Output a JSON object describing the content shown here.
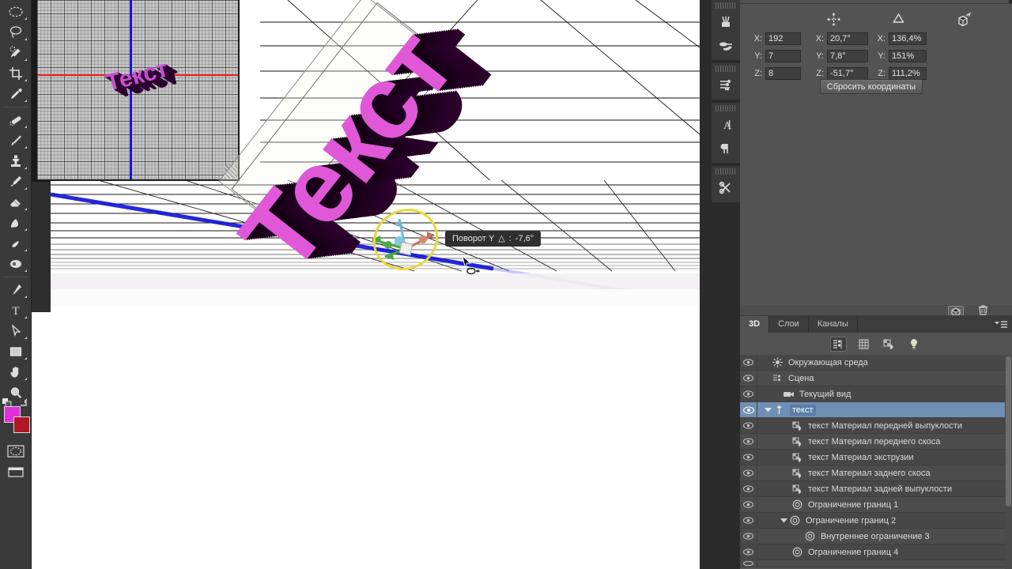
{
  "app": {
    "name": "Adobe Photoshop 3D",
    "locale": "ru"
  },
  "toolbar": {
    "tools": [
      {
        "name": "elliptical-marquee-icon",
        "label": "Овальная область"
      },
      {
        "name": "lasso-icon",
        "label": "Лассо"
      },
      {
        "name": "quick-selection-icon",
        "label": "Быстрое выделение"
      },
      {
        "name": "crop-icon",
        "label": "Рамка"
      },
      {
        "name": "eyedropper-icon",
        "label": "Пипетка"
      },
      {
        "name": "spot-healing-icon",
        "label": "Точечная восстанавливающая кисть"
      },
      {
        "name": "brush-icon",
        "label": "Кисть"
      },
      {
        "name": "clone-stamp-icon",
        "label": "Штамп"
      },
      {
        "name": "history-brush-icon",
        "label": "Архивная кисть"
      },
      {
        "name": "eraser-icon",
        "label": "Ластик"
      },
      {
        "name": "gradient-icon",
        "label": "Градиент"
      },
      {
        "name": "blur-icon",
        "label": "Размытие"
      },
      {
        "name": "dodge-icon",
        "label": "Осветлитель"
      },
      {
        "name": "pen-icon",
        "label": "Перо"
      },
      {
        "name": "type-icon",
        "label": "Текст"
      },
      {
        "name": "path-selection-icon",
        "label": "Выделение контура"
      },
      {
        "name": "rectangle-shape-icon",
        "label": "Прямоугольник"
      },
      {
        "name": "hand-icon",
        "label": "Рука"
      },
      {
        "name": "zoom-icon",
        "label": "Масштаб"
      }
    ],
    "foreground_color": "#e02fd8",
    "background_color": "#b0182a",
    "quickmask_label": "Быстрая маска"
  },
  "canvas": {
    "object_text": "Текст",
    "object_color": "#e058d8",
    "extrusion_color": "#1a001a",
    "rotation_ring_color": "#e8d73a",
    "tooltip": {
      "label": "Поворот Y",
      "symbol": "△",
      "separator": ":",
      "value": "-7,6°"
    },
    "preview": {
      "grid_background": "#c8c8c8",
      "x_axis_color": "#ee1c1c",
      "y_axis_color": "#1414d8"
    },
    "ground_axis_color": "#1414d8"
  },
  "minidock": {
    "groups": [
      {
        "items": [
          {
            "name": "brush-presets-icon",
            "label": "Наборы кистей"
          },
          {
            "name": "brush-settings-icon",
            "label": "Кисть"
          }
        ]
      },
      {
        "items": [
          {
            "name": "adjustments-icon",
            "label": "Коррекция"
          }
        ]
      },
      {
        "items": [
          {
            "name": "character-icon",
            "label": "Символ"
          },
          {
            "name": "paragraph-icon",
            "label": "Абзац"
          }
        ]
      },
      {
        "items": [
          {
            "name": "tool-presets-icon",
            "label": "Наборы инструментов"
          }
        ]
      }
    ]
  },
  "properties": {
    "columns": [
      {
        "icon": "move-coordinates-icon",
        "label": "Положение"
      },
      {
        "icon": "rotate-coordinates-icon",
        "label": "Поворот"
      },
      {
        "icon": "scale-coordinates-icon",
        "label": "Масштаб"
      }
    ],
    "rows": [
      {
        "axis": "X:",
        "position": "192",
        "rotation": "20,7°",
        "scale": "136,4%"
      },
      {
        "axis": "Y:",
        "position": "7",
        "rotation": "7,8°",
        "scale": "151%"
      },
      {
        "axis": "Z:",
        "position": "8",
        "rotation": "-51,7°",
        "scale": "111,2%"
      }
    ],
    "reset_button": "Сбросить координаты",
    "footer_icons": [
      {
        "name": "render-3d-icon",
        "label": "Рендеринг"
      },
      {
        "name": "trash-icon",
        "label": "Удалить"
      }
    ]
  },
  "panel3d": {
    "tabs": [
      {
        "label": "3D",
        "active": true
      },
      {
        "label": "Слои",
        "active": false
      },
      {
        "label": "Каналы",
        "active": false
      }
    ],
    "menu_icon": "panel-menu-icon",
    "filters": [
      {
        "name": "filter-scene-icon",
        "label": "Вся сцена",
        "active": true
      },
      {
        "name": "filter-mesh-icon",
        "label": "Сетки",
        "active": false
      },
      {
        "name": "filter-material-icon",
        "label": "Материалы",
        "active": false
      },
      {
        "name": "filter-light-icon",
        "label": "Источники света",
        "active": false
      }
    ],
    "items": [
      {
        "label": "Окружающая среда",
        "icon": "environment-icon",
        "indent": 0,
        "twirl": "",
        "selected": false,
        "visible": true
      },
      {
        "label": "Сцена",
        "icon": "scene-icon",
        "indent": 0,
        "twirl": "",
        "selected": false,
        "visible": true
      },
      {
        "label": "Текущий вид",
        "icon": "camera-icon",
        "indent": 1,
        "twirl": "",
        "selected": false,
        "visible": true
      },
      {
        "label": "текст",
        "icon": "mesh-icon",
        "indent": 1,
        "twirl": "down",
        "selected": true,
        "visible": true
      },
      {
        "label": "текст Материал передней выпуклости",
        "icon": "material-icon",
        "indent": 2,
        "twirl": "",
        "selected": false,
        "visible": true
      },
      {
        "label": "текст Материал переднего скоса",
        "icon": "material-icon",
        "indent": 2,
        "twirl": "",
        "selected": false,
        "visible": true
      },
      {
        "label": "текст Материал экструзии",
        "icon": "material-icon",
        "indent": 2,
        "twirl": "",
        "selected": false,
        "visible": true
      },
      {
        "label": "текст Материал заднего скоса",
        "icon": "material-icon",
        "indent": 2,
        "twirl": "",
        "selected": false,
        "visible": true
      },
      {
        "label": "текст Материал задней выпуклости",
        "icon": "material-icon",
        "indent": 2,
        "twirl": "",
        "selected": false,
        "visible": true
      },
      {
        "label": "Ограничение границ 1",
        "icon": "constraint-icon",
        "indent": 2,
        "twirl": "",
        "selected": false,
        "visible": true
      },
      {
        "label": "Ограничение границ 2",
        "icon": "constraint-icon",
        "indent": 2,
        "twirl": "down",
        "selected": false,
        "visible": true
      },
      {
        "label": "Внутреннее ограничение 3",
        "icon": "constraint-icon",
        "indent": 3,
        "twirl": "",
        "selected": false,
        "visible": true
      },
      {
        "label": "Ограничение границ 4",
        "icon": "constraint-icon",
        "indent": 2,
        "twirl": "",
        "selected": false,
        "visible": true
      }
    ]
  }
}
